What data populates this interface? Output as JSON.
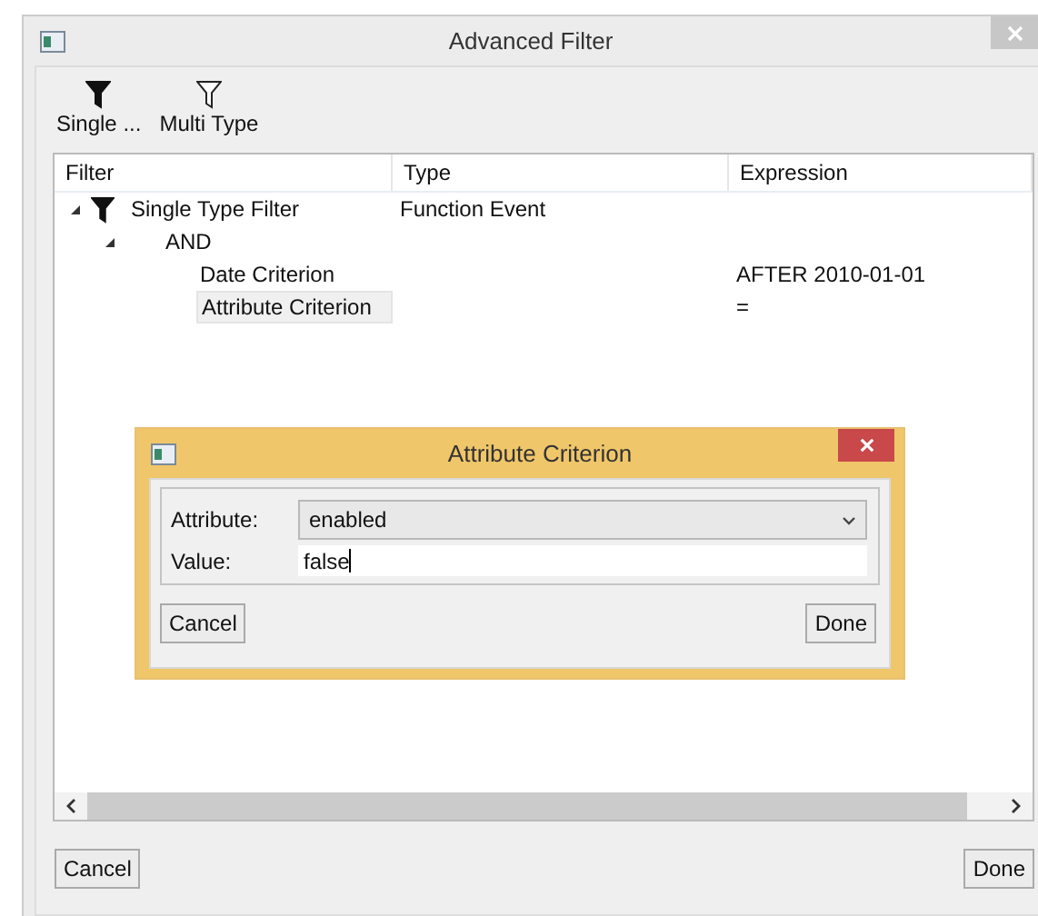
{
  "window": {
    "title": "Advanced Filter"
  },
  "toolbar": [
    {
      "label": "Single ...",
      "kind": "filled"
    },
    {
      "label": "Multi Type",
      "kind": "outline"
    }
  ],
  "tree": {
    "columns": [
      "Filter",
      "Type",
      "Expression"
    ],
    "rows": [
      {
        "kind": "filter",
        "label": "Single Type Filter",
        "type": "Function Event",
        "expanded": true,
        "selected": false,
        "children": [
          {
            "label": "AND",
            "expanded": true,
            "selected": false,
            "children": [
              {
                "label": "Date Criterion",
                "expression": "AFTER 2010-01-01",
                "selected": false
              },
              {
                "label": "Attribute Criterion",
                "expression": "=",
                "selected": true
              }
            ]
          }
        ]
      }
    ]
  },
  "buttons": [
    "Cancel",
    "Done"
  ],
  "dialog": {
    "title": "Attribute Criterion",
    "fields": [
      {
        "label": "Attribute:",
        "kind": "dropdown",
        "value": "enabled"
      },
      {
        "label": "Value:",
        "kind": "text",
        "value": "false"
      }
    ],
    "buttons": [
      "Cancel",
      "Done"
    ]
  }
}
